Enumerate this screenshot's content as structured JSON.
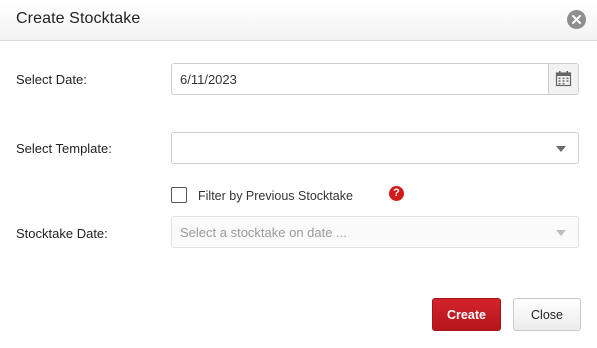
{
  "dialog": {
    "title": "Create Stocktake",
    "close_icon": "close-icon"
  },
  "form": {
    "date_label": "Select Date:",
    "date_value": "6/11/2023",
    "calendar_icon": "calendar-icon",
    "template_label": "Select Template:",
    "template_value": "",
    "filter_label": "Filter by Previous Stocktake",
    "filter_checked": false,
    "help_icon_text": "?",
    "stocktake_date_label": "Stocktake Date:",
    "stocktake_date_placeholder": "Select a stocktake on date ..."
  },
  "footer": {
    "create_label": "Create",
    "close_label": "Close"
  },
  "colors": {
    "primary": "#c41a21",
    "help": "#d31a1a"
  }
}
